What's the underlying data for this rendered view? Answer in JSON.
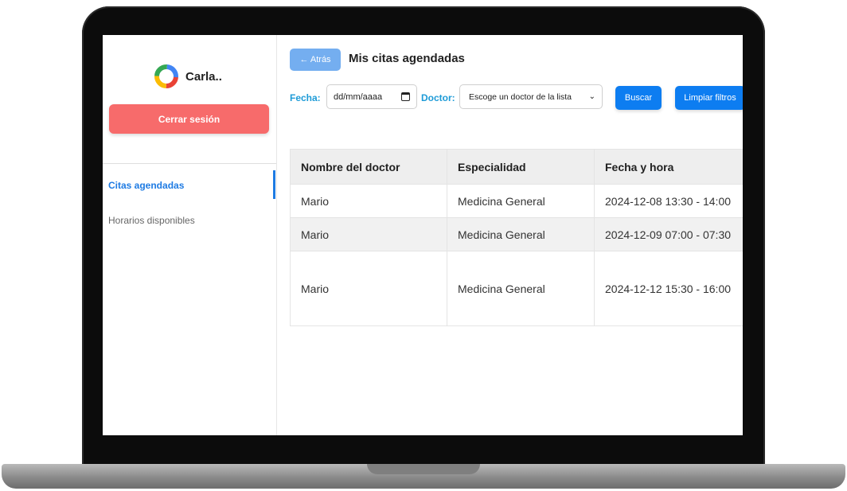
{
  "sidebar": {
    "brand": "Carla..",
    "logout_label": "Cerrar sesión",
    "items": [
      {
        "label": "Citas agendadas",
        "active": true
      },
      {
        "label": "Horarios disponibles",
        "active": false
      }
    ]
  },
  "header": {
    "back_label": "← Atrás",
    "title": "Mis citas agendadas"
  },
  "filters": {
    "fecha_label": "Fecha:",
    "date_placeholder": "dd/mm/aaaa",
    "doctor_label": "Doctor:",
    "doctor_select_value": "Escoge un doctor de la lista",
    "search_label": "Buscar",
    "clear_label": "Limpiar filtros"
  },
  "table": {
    "columns": [
      "Nombre del doctor",
      "Especialidad",
      "Fecha y hora"
    ],
    "rows": [
      [
        "Mario",
        "Medicina General",
        "2024-12-08 13:30 - 14:00"
      ],
      [
        "Mario",
        "Medicina General",
        "2024-12-09 07:00 - 07:30"
      ],
      [
        "Mario",
        "Medicina General",
        "2024-12-12 15:30 - 16:00"
      ]
    ]
  },
  "colors": {
    "accent": "#1e7be3",
    "logout": "#f76b6b",
    "button_blue": "#0d7df1",
    "label_teal": "#1e9bd7"
  }
}
